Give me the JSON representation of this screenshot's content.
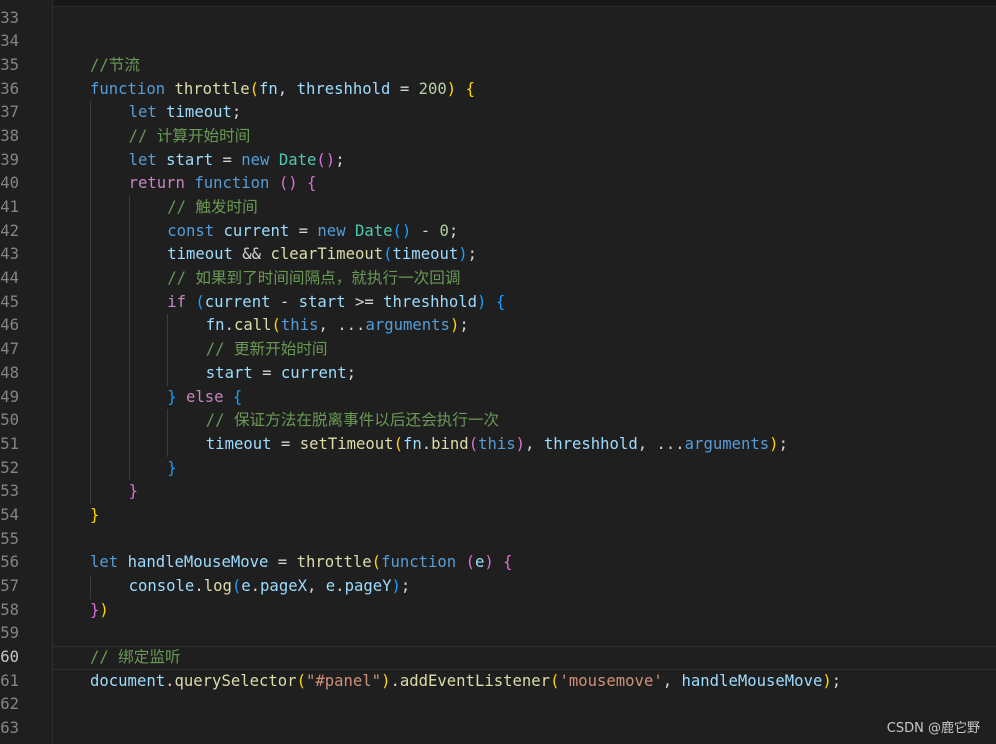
{
  "editor": {
    "theme": {
      "background": "#1f1f1f",
      "line_number": "#858585",
      "keyword": "#569cd6",
      "control": "#c586c0",
      "function": "#dcdcaa",
      "variable": "#9cdcfe",
      "number": "#b5cea8",
      "string": "#ce9178",
      "comment": "#6a9955",
      "bracket_1": "#ffd700",
      "bracket_2": "#da70d6",
      "bracket_3": "#179fff"
    },
    "current_line": "60",
    "lines": [
      {
        "num": "33",
        "indent": 0,
        "tokens": []
      },
      {
        "num": "34",
        "indent": 0,
        "tokens": []
      },
      {
        "num": "35",
        "indent": 1,
        "tokens": [
          {
            "t": "//节流",
            "c": "com"
          }
        ]
      },
      {
        "num": "36",
        "indent": 1,
        "tokens": [
          {
            "t": "function",
            "c": "kw"
          },
          {
            "t": " "
          },
          {
            "t": "throttle",
            "c": "fn"
          },
          {
            "t": "(",
            "c": "b1"
          },
          {
            "t": "fn",
            "c": "var"
          },
          {
            "t": ", "
          },
          {
            "t": "threshhold",
            "c": "var"
          },
          {
            "t": " = "
          },
          {
            "t": "200",
            "c": "num"
          },
          {
            "t": ")",
            "c": "b1"
          },
          {
            "t": " "
          },
          {
            "t": "{",
            "c": "b1"
          }
        ]
      },
      {
        "num": "37",
        "indent": 2,
        "tokens": [
          {
            "t": "let",
            "c": "kw"
          },
          {
            "t": " "
          },
          {
            "t": "timeout",
            "c": "var"
          },
          {
            "t": ";"
          }
        ]
      },
      {
        "num": "38",
        "indent": 2,
        "tokens": [
          {
            "t": "// 计算开始时间",
            "c": "com"
          }
        ]
      },
      {
        "num": "39",
        "indent": 2,
        "tokens": [
          {
            "t": "let",
            "c": "kw"
          },
          {
            "t": " "
          },
          {
            "t": "start",
            "c": "var"
          },
          {
            "t": " = "
          },
          {
            "t": "new",
            "c": "kw"
          },
          {
            "t": " "
          },
          {
            "t": "Date",
            "c": "cls"
          },
          {
            "t": "()",
            "c": "b2"
          },
          {
            "t": ";"
          }
        ]
      },
      {
        "num": "40",
        "indent": 2,
        "tokens": [
          {
            "t": "return",
            "c": "ctl"
          },
          {
            "t": " "
          },
          {
            "t": "function",
            "c": "kw"
          },
          {
            "t": " "
          },
          {
            "t": "()",
            "c": "b2"
          },
          {
            "t": " "
          },
          {
            "t": "{",
            "c": "b2"
          }
        ]
      },
      {
        "num": "41",
        "indent": 3,
        "tokens": [
          {
            "t": "// 触发时间",
            "c": "com"
          }
        ]
      },
      {
        "num": "42",
        "indent": 3,
        "tokens": [
          {
            "t": "const",
            "c": "kw"
          },
          {
            "t": " "
          },
          {
            "t": "current",
            "c": "var"
          },
          {
            "t": " = "
          },
          {
            "t": "new",
            "c": "kw"
          },
          {
            "t": " "
          },
          {
            "t": "Date",
            "c": "cls"
          },
          {
            "t": "()",
            "c": "b3"
          },
          {
            "t": " - "
          },
          {
            "t": "0",
            "c": "num"
          },
          {
            "t": ";"
          }
        ]
      },
      {
        "num": "43",
        "indent": 3,
        "tokens": [
          {
            "t": "timeout",
            "c": "var"
          },
          {
            "t": " && "
          },
          {
            "t": "clearTimeout",
            "c": "fn"
          },
          {
            "t": "(",
            "c": "b3"
          },
          {
            "t": "timeout",
            "c": "var"
          },
          {
            "t": ")",
            "c": "b3"
          },
          {
            "t": ";"
          }
        ]
      },
      {
        "num": "44",
        "indent": 3,
        "tokens": [
          {
            "t": "// 如果到了时间间隔点，就执行一次回调",
            "c": "com"
          }
        ]
      },
      {
        "num": "45",
        "indent": 3,
        "tokens": [
          {
            "t": "if",
            "c": "ctl"
          },
          {
            "t": " "
          },
          {
            "t": "(",
            "c": "b3"
          },
          {
            "t": "current",
            "c": "var"
          },
          {
            "t": " - "
          },
          {
            "t": "start",
            "c": "var"
          },
          {
            "t": " >= "
          },
          {
            "t": "threshhold",
            "c": "var"
          },
          {
            "t": ")",
            "c": "b3"
          },
          {
            "t": " "
          },
          {
            "t": "{",
            "c": "b3"
          }
        ]
      },
      {
        "num": "46",
        "indent": 4,
        "tokens": [
          {
            "t": "fn",
            "c": "var"
          },
          {
            "t": "."
          },
          {
            "t": "call",
            "c": "fn"
          },
          {
            "t": "(",
            "c": "b1"
          },
          {
            "t": "this",
            "c": "kw"
          },
          {
            "t": ", ..."
          },
          {
            "t": "arguments",
            "c": "kw"
          },
          {
            "t": ")",
            "c": "b1"
          },
          {
            "t": ";"
          }
        ]
      },
      {
        "num": "47",
        "indent": 4,
        "tokens": [
          {
            "t": "// 更新开始时间",
            "c": "com"
          }
        ]
      },
      {
        "num": "48",
        "indent": 4,
        "tokens": [
          {
            "t": "start",
            "c": "var"
          },
          {
            "t": " = "
          },
          {
            "t": "current",
            "c": "var"
          },
          {
            "t": ";"
          }
        ]
      },
      {
        "num": "49",
        "indent": 3,
        "tokens": [
          {
            "t": "}",
            "c": "b3"
          },
          {
            "t": " "
          },
          {
            "t": "else",
            "c": "ctl"
          },
          {
            "t": " "
          },
          {
            "t": "{",
            "c": "b3"
          }
        ]
      },
      {
        "num": "50",
        "indent": 4,
        "tokens": [
          {
            "t": "// 保证方法在脱离事件以后还会执行一次",
            "c": "com"
          }
        ]
      },
      {
        "num": "51",
        "indent": 4,
        "tokens": [
          {
            "t": "timeout",
            "c": "var"
          },
          {
            "t": " = "
          },
          {
            "t": "setTimeout",
            "c": "fn"
          },
          {
            "t": "(",
            "c": "b1"
          },
          {
            "t": "fn",
            "c": "var"
          },
          {
            "t": "."
          },
          {
            "t": "bind",
            "c": "fn"
          },
          {
            "t": "(",
            "c": "b2"
          },
          {
            "t": "this",
            "c": "kw"
          },
          {
            "t": ")",
            "c": "b2"
          },
          {
            "t": ", "
          },
          {
            "t": "threshhold",
            "c": "var"
          },
          {
            "t": ", ..."
          },
          {
            "t": "arguments",
            "c": "kw"
          },
          {
            "t": ")",
            "c": "b1"
          },
          {
            "t": ";"
          }
        ]
      },
      {
        "num": "52",
        "indent": 3,
        "tokens": [
          {
            "t": "}",
            "c": "b3"
          }
        ]
      },
      {
        "num": "53",
        "indent": 2,
        "tokens": [
          {
            "t": "}",
            "c": "b2"
          }
        ]
      },
      {
        "num": "54",
        "indent": 1,
        "tokens": [
          {
            "t": "}",
            "c": "b1"
          }
        ]
      },
      {
        "num": "55",
        "indent": 0,
        "tokens": []
      },
      {
        "num": "56",
        "indent": 1,
        "tokens": [
          {
            "t": "let",
            "c": "kw"
          },
          {
            "t": " "
          },
          {
            "t": "handleMouseMove",
            "c": "var"
          },
          {
            "t": " = "
          },
          {
            "t": "throttle",
            "c": "fn"
          },
          {
            "t": "(",
            "c": "b1"
          },
          {
            "t": "function",
            "c": "kw"
          },
          {
            "t": " "
          },
          {
            "t": "(",
            "c": "b2"
          },
          {
            "t": "e",
            "c": "var"
          },
          {
            "t": ")",
            "c": "b2"
          },
          {
            "t": " "
          },
          {
            "t": "{",
            "c": "b2"
          }
        ]
      },
      {
        "num": "57",
        "indent": 2,
        "tokens": [
          {
            "t": "console",
            "c": "var"
          },
          {
            "t": "."
          },
          {
            "t": "log",
            "c": "fn"
          },
          {
            "t": "(",
            "c": "b3"
          },
          {
            "t": "e",
            "c": "var"
          },
          {
            "t": "."
          },
          {
            "t": "pageX",
            "c": "var"
          },
          {
            "t": ", "
          },
          {
            "t": "e",
            "c": "var"
          },
          {
            "t": "."
          },
          {
            "t": "pageY",
            "c": "var"
          },
          {
            "t": ")",
            "c": "b3"
          },
          {
            "t": ";"
          }
        ]
      },
      {
        "num": "58",
        "indent": 1,
        "tokens": [
          {
            "t": "}",
            "c": "b2"
          },
          {
            "t": ")",
            "c": "b1"
          }
        ]
      },
      {
        "num": "59",
        "indent": 0,
        "tokens": []
      },
      {
        "num": "60",
        "indent": 1,
        "tokens": [
          {
            "t": "// 绑定监听",
            "c": "com"
          }
        ]
      },
      {
        "num": "61",
        "indent": 1,
        "tokens": [
          {
            "t": "document",
            "c": "var"
          },
          {
            "t": "."
          },
          {
            "t": "querySelector",
            "c": "fn"
          },
          {
            "t": "(",
            "c": "b1"
          },
          {
            "t": "\"#panel\"",
            "c": "str"
          },
          {
            "t": ")",
            "c": "b1"
          },
          {
            "t": "."
          },
          {
            "t": "addEventListener",
            "c": "fn"
          },
          {
            "t": "(",
            "c": "b1"
          },
          {
            "t": "'mousemove'",
            "c": "str"
          },
          {
            "t": ", "
          },
          {
            "t": "handleMouseMove",
            "c": "var"
          },
          {
            "t": ")",
            "c": "b1"
          },
          {
            "t": ";"
          }
        ]
      },
      {
        "num": "62",
        "indent": 0,
        "tokens": []
      },
      {
        "num": "63",
        "indent": 0,
        "tokens": []
      }
    ]
  },
  "watermark": {
    "text": "CSDN @鹿它野"
  }
}
